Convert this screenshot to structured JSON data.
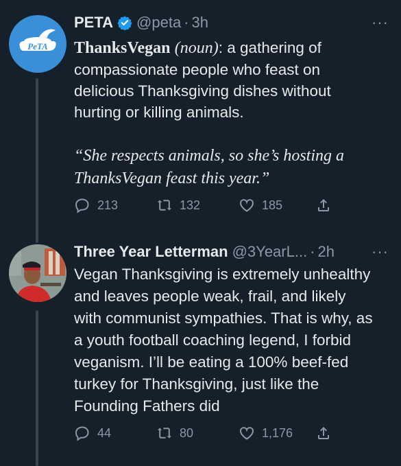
{
  "tweets": [
    {
      "name": "PETA",
      "handle": "@peta",
      "dot": "·",
      "time": "3h",
      "more": "···",
      "avatar_logo_text": "PeTA",
      "def_term": "ThanksVegan",
      "def_pos": "(noun)",
      "def_rest": ": a gathering of compassionate people who feast on delicious Thanksgiving dishes without hurting or killing animals.",
      "quote": "“She respects animals, so she’s hosting a ThanksVegan feast this year.”",
      "replies": "213",
      "retweets": "132",
      "likes": "185"
    },
    {
      "name": "Three Year Letterman",
      "handle": "@3YearL...",
      "dot": "·",
      "time": "2h",
      "more": "···",
      "text": "Vegan Thanksgiving is extremely unhealthy and leaves people weak, frail, and likely with communist sympathies. That is why, as a youth football coaching legend, I forbid veganism. I’ll be eating a 100% beef-fed turkey for Thanksgiving, just like the Founding Fathers did",
      "replies": "44",
      "retweets": "80",
      "likes": "1,176"
    }
  ],
  "colors": {
    "background": "#15202b",
    "text": "#e7e9ea",
    "secondary": "#8b98a5",
    "verified": "#1d9bf0",
    "peta_blue": "#3a8fd9"
  }
}
